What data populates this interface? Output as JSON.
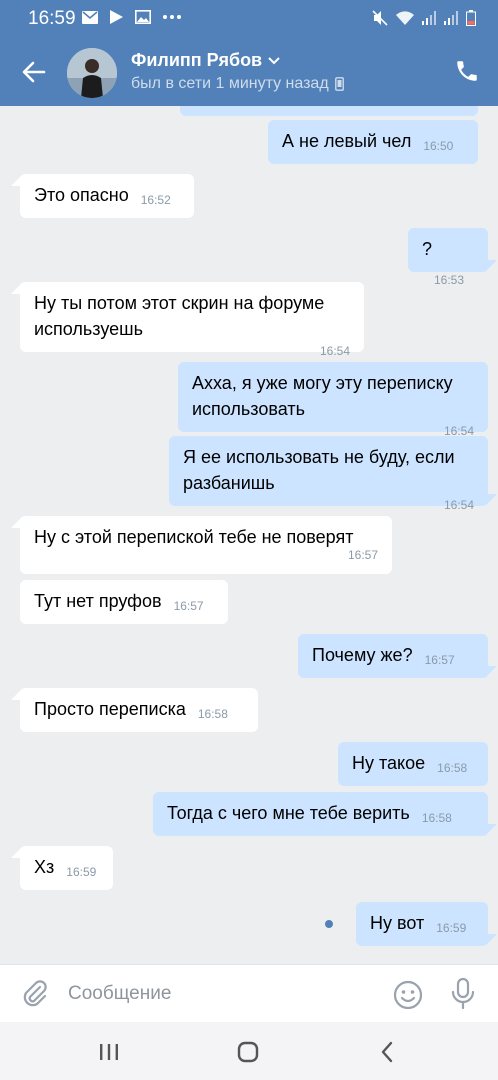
{
  "status_bar": {
    "time": "16:59"
  },
  "header": {
    "contact_name": "Филипп Рябов",
    "contact_status": "был в сети 1 минуту назад"
  },
  "messages": [
    {
      "dir": "out",
      "text": "А не левый чел",
      "time": "16:50"
    },
    {
      "dir": "in",
      "text": "Это опасно",
      "time": "16:52"
    },
    {
      "dir": "out",
      "text": "?",
      "time": "16:53"
    },
    {
      "dir": "in",
      "text": "Ну ты потом этот скрин на форуме используешь",
      "time": "16:54"
    },
    {
      "dir": "out",
      "text": "Ахха, я уже могу эту переписку использовать",
      "time": "16:54"
    },
    {
      "dir": "out",
      "text": "Я ее использовать не буду, если разбанишь",
      "time": "16:54"
    },
    {
      "dir": "in",
      "text": "Ну с этой перепиской тебе не поверят",
      "time": "16:57"
    },
    {
      "dir": "in",
      "text": "Тут нет пруфов",
      "time": "16:57"
    },
    {
      "dir": "out",
      "text": "Почему же?",
      "time": "16:57"
    },
    {
      "dir": "in",
      "text": "Просто переписка",
      "time": "16:58"
    },
    {
      "dir": "out",
      "text": "Ну такое",
      "time": "16:58"
    },
    {
      "dir": "out",
      "text": "Тогда с чего мне тебе верить",
      "time": "16:58"
    },
    {
      "dir": "in",
      "text": "Хз",
      "time": "16:59"
    },
    {
      "dir": "out",
      "text": "Ну вот",
      "time": "16:59"
    }
  ],
  "composer": {
    "placeholder": "Сообщение"
  },
  "colors": {
    "header": "#5181b8",
    "outgoing_bubble": "#cce4ff",
    "incoming_bubble": "#ffffff",
    "chat_bg": "#edeef0"
  },
  "icons": [
    "back-arrow-icon",
    "chevron-down-icon",
    "mobile-icon",
    "phone-icon",
    "paperclip-icon",
    "smile-icon",
    "mic-icon",
    "recent-apps-icon",
    "home-icon",
    "nav-back-icon"
  ]
}
